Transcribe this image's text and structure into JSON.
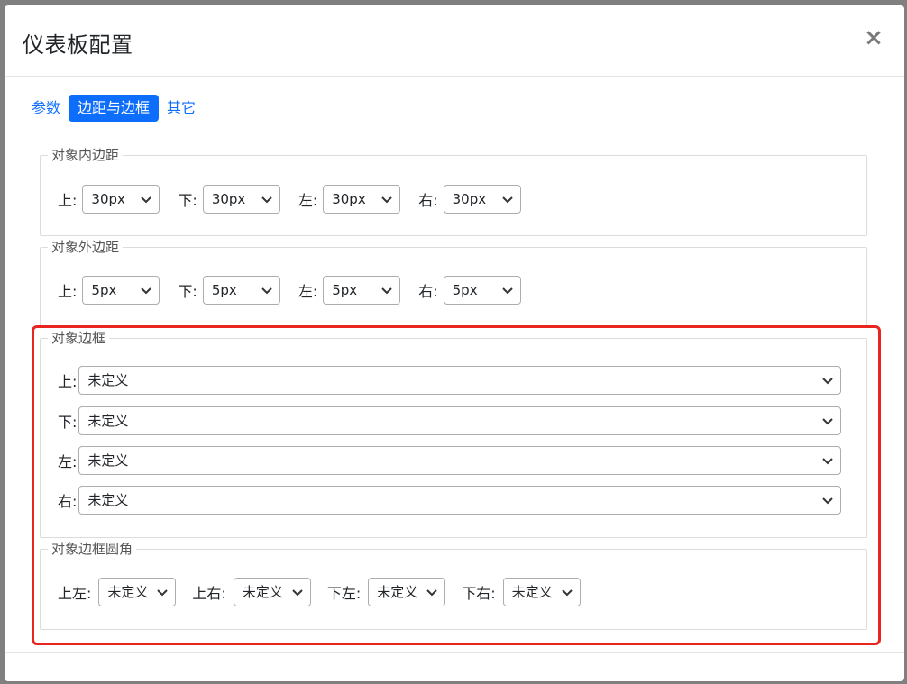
{
  "modal": {
    "title": "仪表板配置",
    "close_glyph": "×"
  },
  "tabs": [
    {
      "label": "参数",
      "active": false
    },
    {
      "label": "边距与边框",
      "active": true
    },
    {
      "label": "其它",
      "active": false
    }
  ],
  "padding": {
    "legend": "对象内边距",
    "fields": [
      {
        "label": "上:",
        "value": "30px"
      },
      {
        "label": "下:",
        "value": "30px"
      },
      {
        "label": "左:",
        "value": "30px"
      },
      {
        "label": "右:",
        "value": "30px"
      }
    ]
  },
  "margin": {
    "legend": "对象外边距",
    "fields": [
      {
        "label": "上:",
        "value": "5px"
      },
      {
        "label": "下:",
        "value": "5px"
      },
      {
        "label": "左:",
        "value": "5px"
      },
      {
        "label": "右:",
        "value": "5px"
      }
    ]
  },
  "border": {
    "legend": "对象边框",
    "fields": [
      {
        "label": "上:",
        "value": "未定义"
      },
      {
        "label": "下:",
        "value": "未定义"
      },
      {
        "label": "左:",
        "value": "未定义"
      },
      {
        "label": "右:",
        "value": "未定义"
      }
    ]
  },
  "radius": {
    "legend": "对象边框圆角",
    "fields": [
      {
        "label": "上左:",
        "value": "未定义"
      },
      {
        "label": "上右:",
        "value": "未定义"
      },
      {
        "label": "下左:",
        "value": "未定义"
      },
      {
        "label": "下右:",
        "value": "未定义"
      }
    ]
  },
  "colors": {
    "accent": "#0d6efd",
    "highlight": "#e8261f"
  }
}
